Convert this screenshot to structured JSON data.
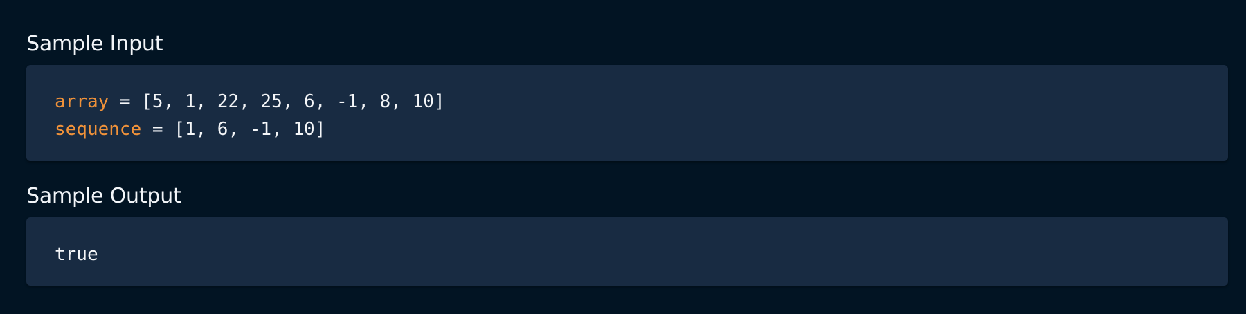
{
  "sample_input": {
    "title": "Sample Input",
    "lines": [
      {
        "name": "array",
        "rest": " = [5, 1, 22, 25, 6, -1, 8, 10]"
      },
      {
        "name": "sequence",
        "rest": " = [1, 6, -1, 10]"
      }
    ]
  },
  "sample_output": {
    "title": "Sample Output",
    "value": "true"
  },
  "colors": {
    "page_background": "#021423",
    "code_background": "#182b42",
    "variable_name": "#f0923a",
    "code_text": "#f4f6f8"
  }
}
